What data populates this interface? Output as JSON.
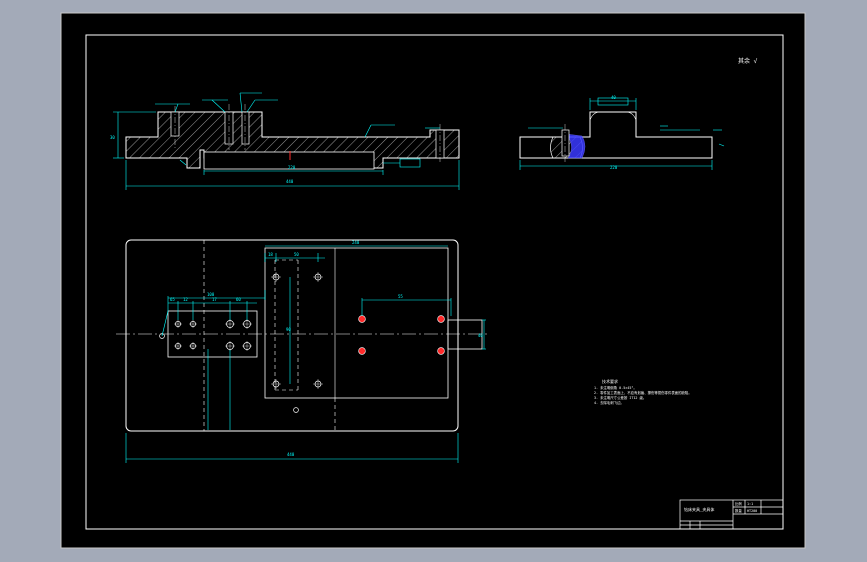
{
  "palette": {
    "background": "#a3aab8",
    "sheet": "#000000",
    "outline": "#ffffff",
    "dimension": "#00ffff",
    "centerline": "#ffffff",
    "hole_red": "#ff2a2a",
    "hatch": "#ffffff",
    "blue_fill": "#3a3aff"
  },
  "roughness_note": "其余 √",
  "tech_requirements": {
    "title": "技术要求",
    "lines": [
      "1. 未注明倒角 0.5×45°。",
      "2. 零件加工表面上，不应有划痕、擦伤等损伤零件表面的缺陷。",
      "3. 未注明尺寸公差按 IT12 级。",
      "4. 去除毛刺飞边。"
    ]
  },
  "title_block": {
    "drawing_name": "钻床夹具_夹具体",
    "scale_label": "比例",
    "scale_value": "1:1",
    "qty_label": "数量",
    "material": "HT200"
  },
  "dims": {
    "front_total": "440",
    "front_inner": "220",
    "front_height": "30",
    "side_total": "220",
    "side_top": "40",
    "plan_total": "440",
    "plan_right": "240",
    "plan_a": "18",
    "plan_b": "50",
    "plan_c": "65",
    "plan_d": "100",
    "plan_e": "12",
    "plan_f": "60",
    "plan_g": "17",
    "plan_h": "55",
    "plan_i": "90",
    "plan_j": "40"
  }
}
